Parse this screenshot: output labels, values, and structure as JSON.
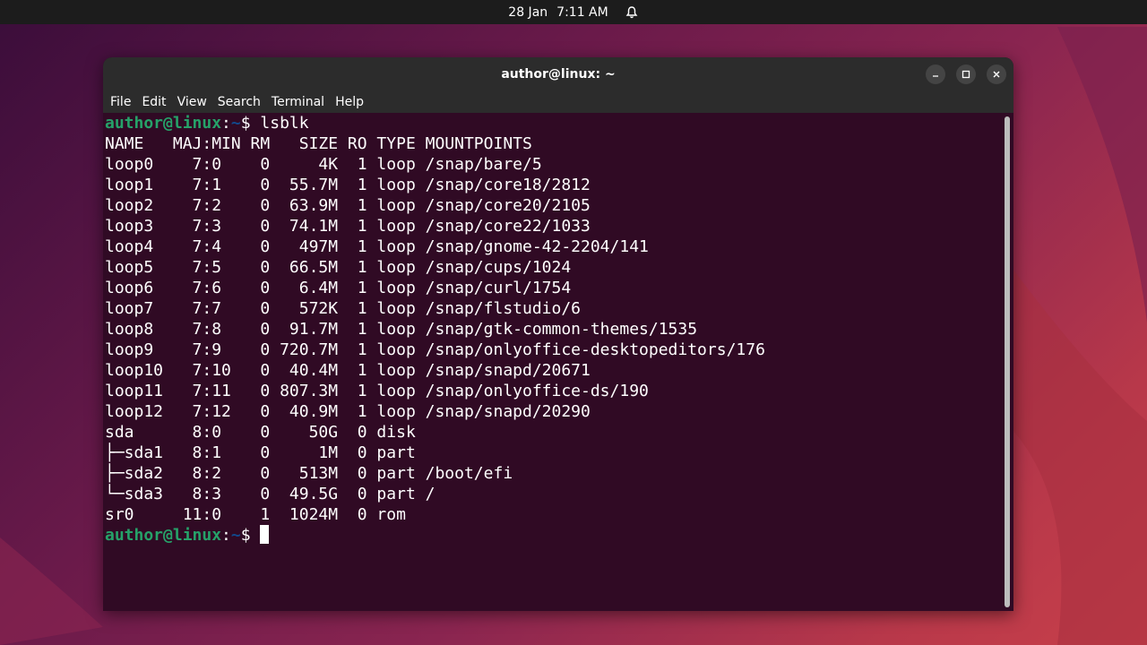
{
  "topbar": {
    "date": "28 Jan",
    "time": "7:11 AM",
    "bell_icon": "bell-icon"
  },
  "window": {
    "title": "author@linux: ~",
    "controls": [
      "minimize-icon",
      "maximize-icon",
      "close-icon"
    ]
  },
  "menu": [
    "File",
    "Edit",
    "View",
    "Search",
    "Terminal",
    "Help"
  ],
  "terminal": {
    "prompt_user": "author@linux",
    "prompt_sep": ":",
    "prompt_path": "~",
    "prompt_dollar": "$ ",
    "command": "lsblk",
    "output": [
      "NAME   MAJ:MIN RM   SIZE RO TYPE MOUNTPOINTS",
      "loop0    7:0    0     4K  1 loop /snap/bare/5",
      "loop1    7:1    0  55.7M  1 loop /snap/core18/2812",
      "loop2    7:2    0  63.9M  1 loop /snap/core20/2105",
      "loop3    7:3    0  74.1M  1 loop /snap/core22/1033",
      "loop4    7:4    0   497M  1 loop /snap/gnome-42-2204/141",
      "loop5    7:5    0  66.5M  1 loop /snap/cups/1024",
      "loop6    7:6    0   6.4M  1 loop /snap/curl/1754",
      "loop7    7:7    0   572K  1 loop /snap/flstudio/6",
      "loop8    7:8    0  91.7M  1 loop /snap/gtk-common-themes/1535",
      "loop9    7:9    0 720.7M  1 loop /snap/onlyoffice-desktopeditors/176",
      "loop10   7:10   0  40.4M  1 loop /snap/snapd/20671",
      "loop11   7:11   0 807.3M  1 loop /snap/onlyoffice-ds/190",
      "loop12   7:12   0  40.9M  1 loop /snap/snapd/20290",
      "sda      8:0    0    50G  0 disk",
      "├─sda1   8:1    0     1M  0 part",
      "├─sda2   8:2    0   513M  0 part /boot/efi",
      "└─sda3   8:3    0  49.5G  0 part /",
      "sr0     11:0    1  1024M  0 rom"
    ]
  },
  "colors": {
    "terminal_bg": "#300a24",
    "prompt_user": "#26a269",
    "prompt_path": "#12488b",
    "titlebar_bg": "#2c2c2c"
  }
}
